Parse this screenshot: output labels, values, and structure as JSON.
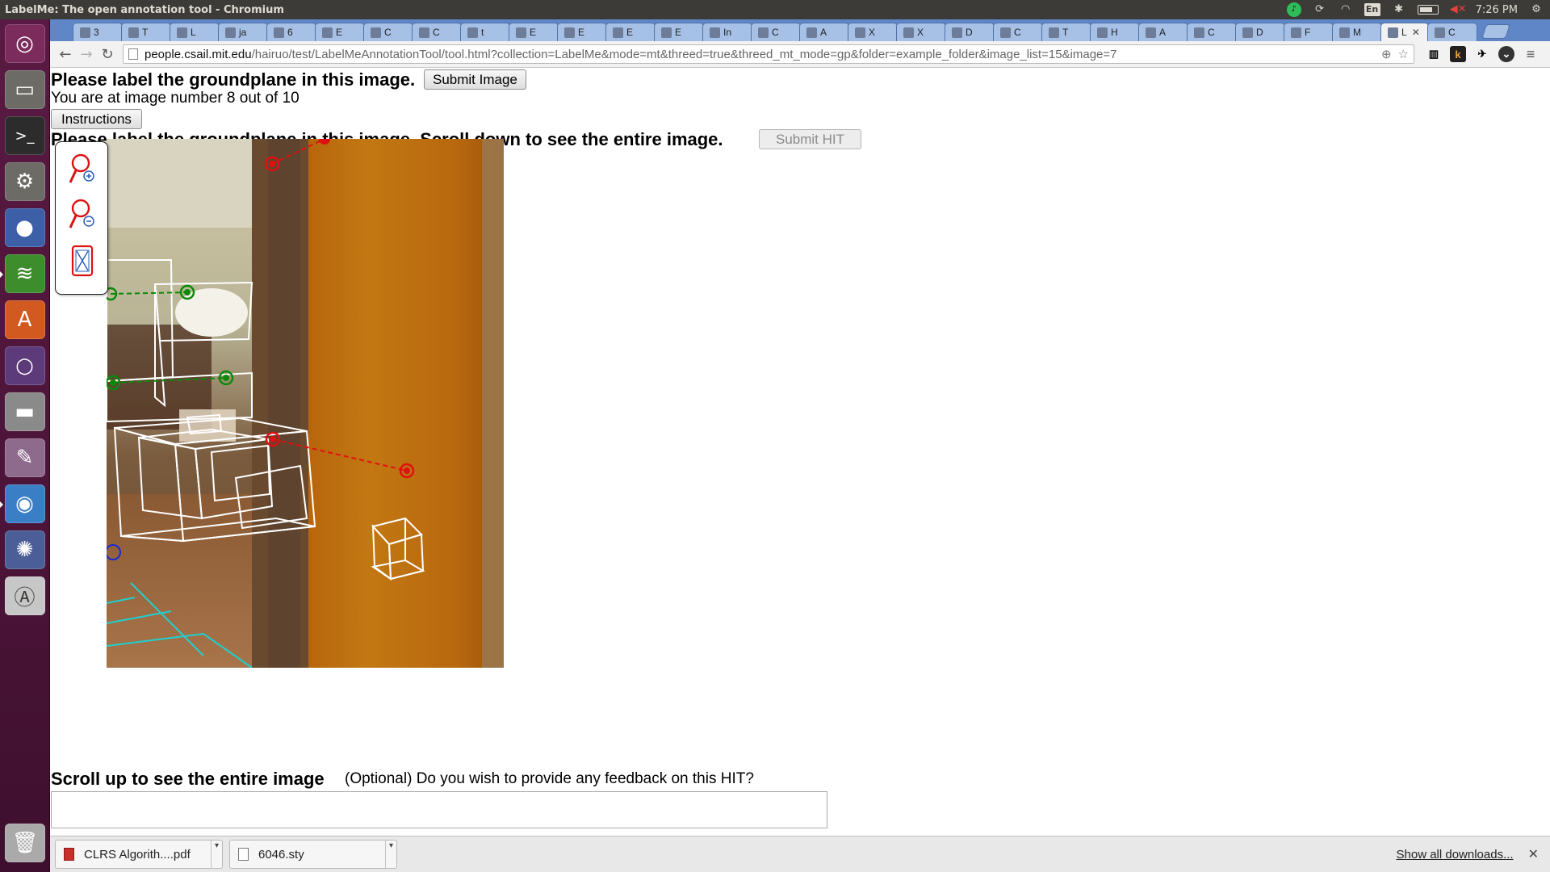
{
  "window": {
    "title": "LabelMe: The open annotation tool - Chromium"
  },
  "tray": {
    "clock": "7:26 PM",
    "lang": "En"
  },
  "tabs": [
    {
      "label": "3"
    },
    {
      "label": "T"
    },
    {
      "label": "L"
    },
    {
      "label": "ja"
    },
    {
      "label": "6"
    },
    {
      "label": "E"
    },
    {
      "label": "C"
    },
    {
      "label": "C"
    },
    {
      "label": "t"
    },
    {
      "label": "E"
    },
    {
      "label": "E"
    },
    {
      "label": "E"
    },
    {
      "label": "E"
    },
    {
      "label": "In"
    },
    {
      "label": "C"
    },
    {
      "label": "A"
    },
    {
      "label": "X"
    },
    {
      "label": "X"
    },
    {
      "label": "D"
    },
    {
      "label": "C"
    },
    {
      "label": "T"
    },
    {
      "label": "H"
    },
    {
      "label": "A"
    },
    {
      "label": "C"
    },
    {
      "label": "D"
    },
    {
      "label": "F"
    },
    {
      "label": "M"
    },
    {
      "label": "L"
    },
    {
      "label": "C"
    }
  ],
  "address": {
    "host": "people.csail.mit.edu",
    "path": "/hairuo/test/LabelMeAnnotationTool/tool.html?collection=LabelMe&mode=mt&threed=true&threed_mt_mode=gp&folder=example_folder&image_list=15&image=7"
  },
  "page": {
    "heading": "Please label the groundplane in this image.",
    "submit_image": "Submit Image",
    "progress": "You are at image number 8 out of 10",
    "instructions": "Instructions",
    "scroll_down_heading": "Please label the groundplane in this image. Scroll down to see the entire image.",
    "submit_hit": "Submit HIT",
    "scroll_up": "Scroll up to see the entire image",
    "feedback_prompt": "(Optional) Do you wish to provide any feedback on this HIT?",
    "feedback_value": ""
  },
  "tools": {
    "zoom_in": "zoom-in-icon",
    "zoom_out": "zoom-out-icon",
    "fit": "fit-to-window-icon"
  },
  "downloads": {
    "items": [
      {
        "name": "CLRS Algorith....pdf"
      },
      {
        "name": "6046.sty"
      }
    ],
    "show_all": "Show all downloads..."
  },
  "colors": {
    "launcher": "#4b1438",
    "tabstrip": "#5f87c8",
    "annotation_red": "#e01010",
    "annotation_green": "#0a8a0a",
    "wall_orange": "#c07012"
  }
}
